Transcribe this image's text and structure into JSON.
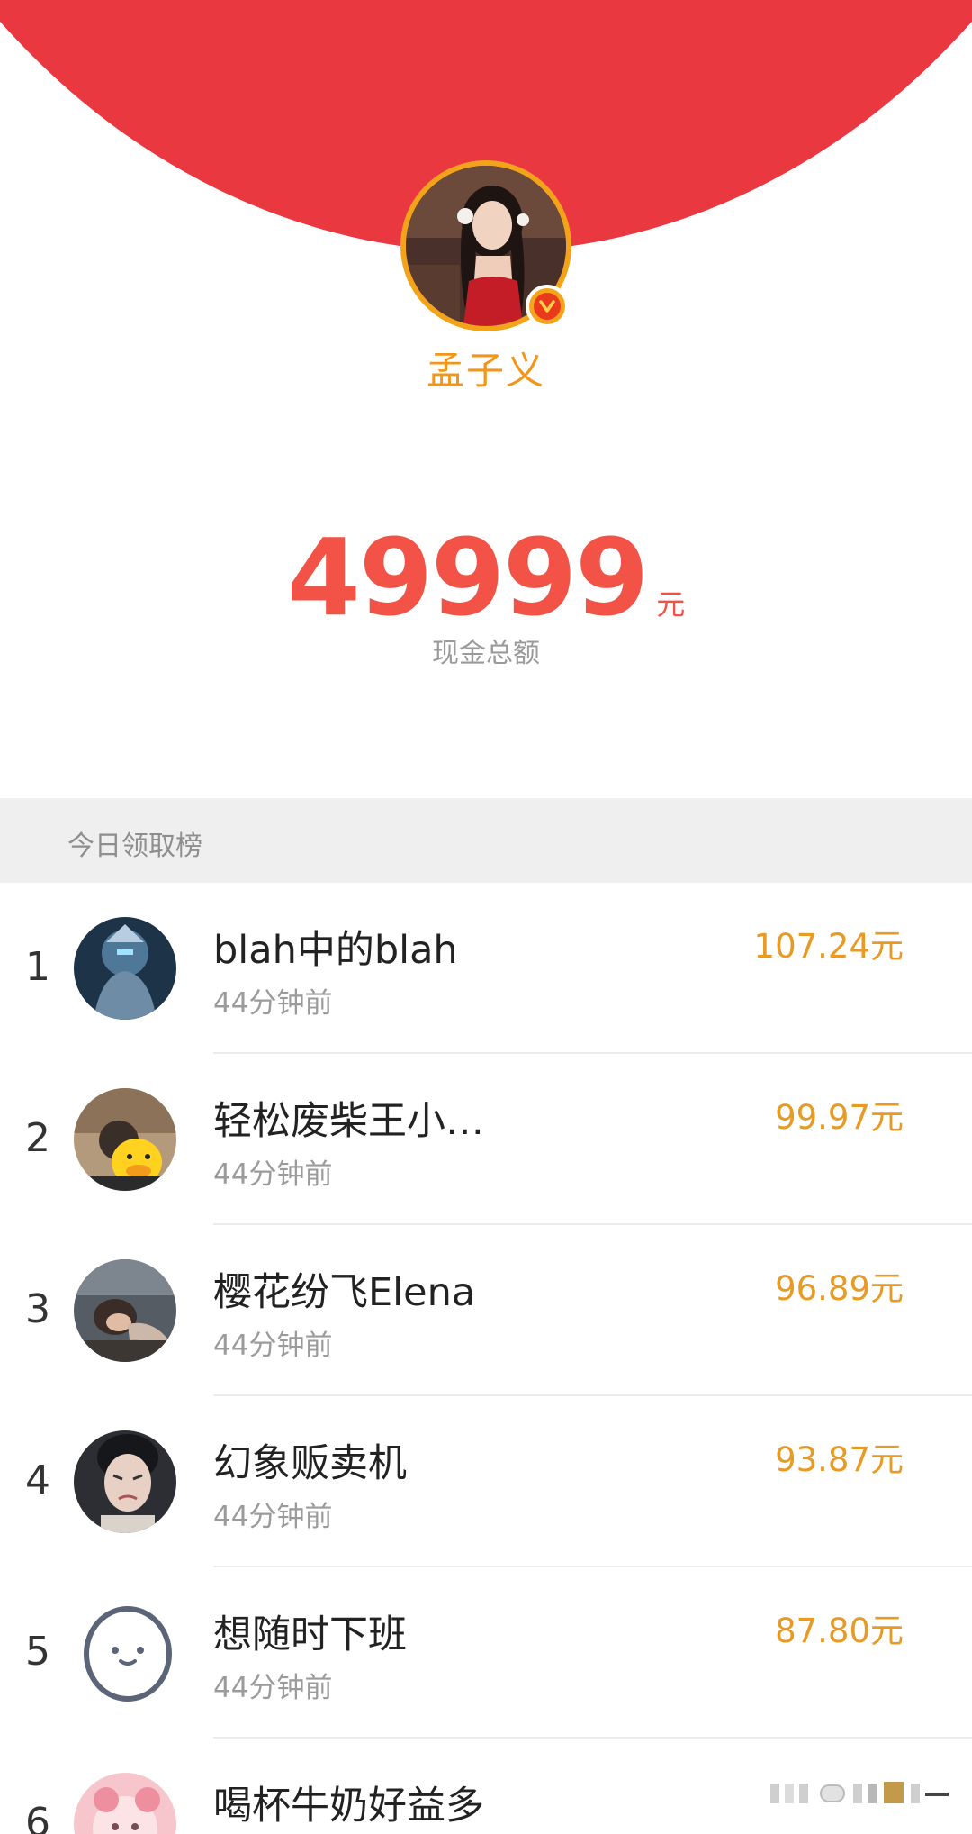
{
  "header": {
    "sender_name": "孟子义",
    "verified_icon": "verified-v-icon",
    "colors": {
      "envelope": "#e93840",
      "band": "#fde1b8",
      "gold": "#f2961b"
    }
  },
  "summary": {
    "amount": "49999",
    "unit": "元",
    "label": "现金总额",
    "color": "#f25346"
  },
  "leaderboard": {
    "title": "今日领取榜",
    "items": [
      {
        "rank": "1",
        "name": "blah中的blah",
        "time": "44分钟前",
        "amount": "107.24元"
      },
      {
        "rank": "2",
        "name": "轻松废柴王小…",
        "time": "44分钟前",
        "amount": "99.97元"
      },
      {
        "rank": "3",
        "name": "樱花纷飞Elena",
        "time": "44分钟前",
        "amount": "96.89元"
      },
      {
        "rank": "4",
        "name": "幻象贩卖机",
        "time": "44分钟前",
        "amount": "93.87元"
      },
      {
        "rank": "5",
        "name": "想随时下班",
        "time": "44分钟前",
        "amount": "87.80元"
      },
      {
        "rank": "6",
        "name": "喝杯牛奶好益多",
        "time": "",
        "amount": ""
      }
    ]
  }
}
